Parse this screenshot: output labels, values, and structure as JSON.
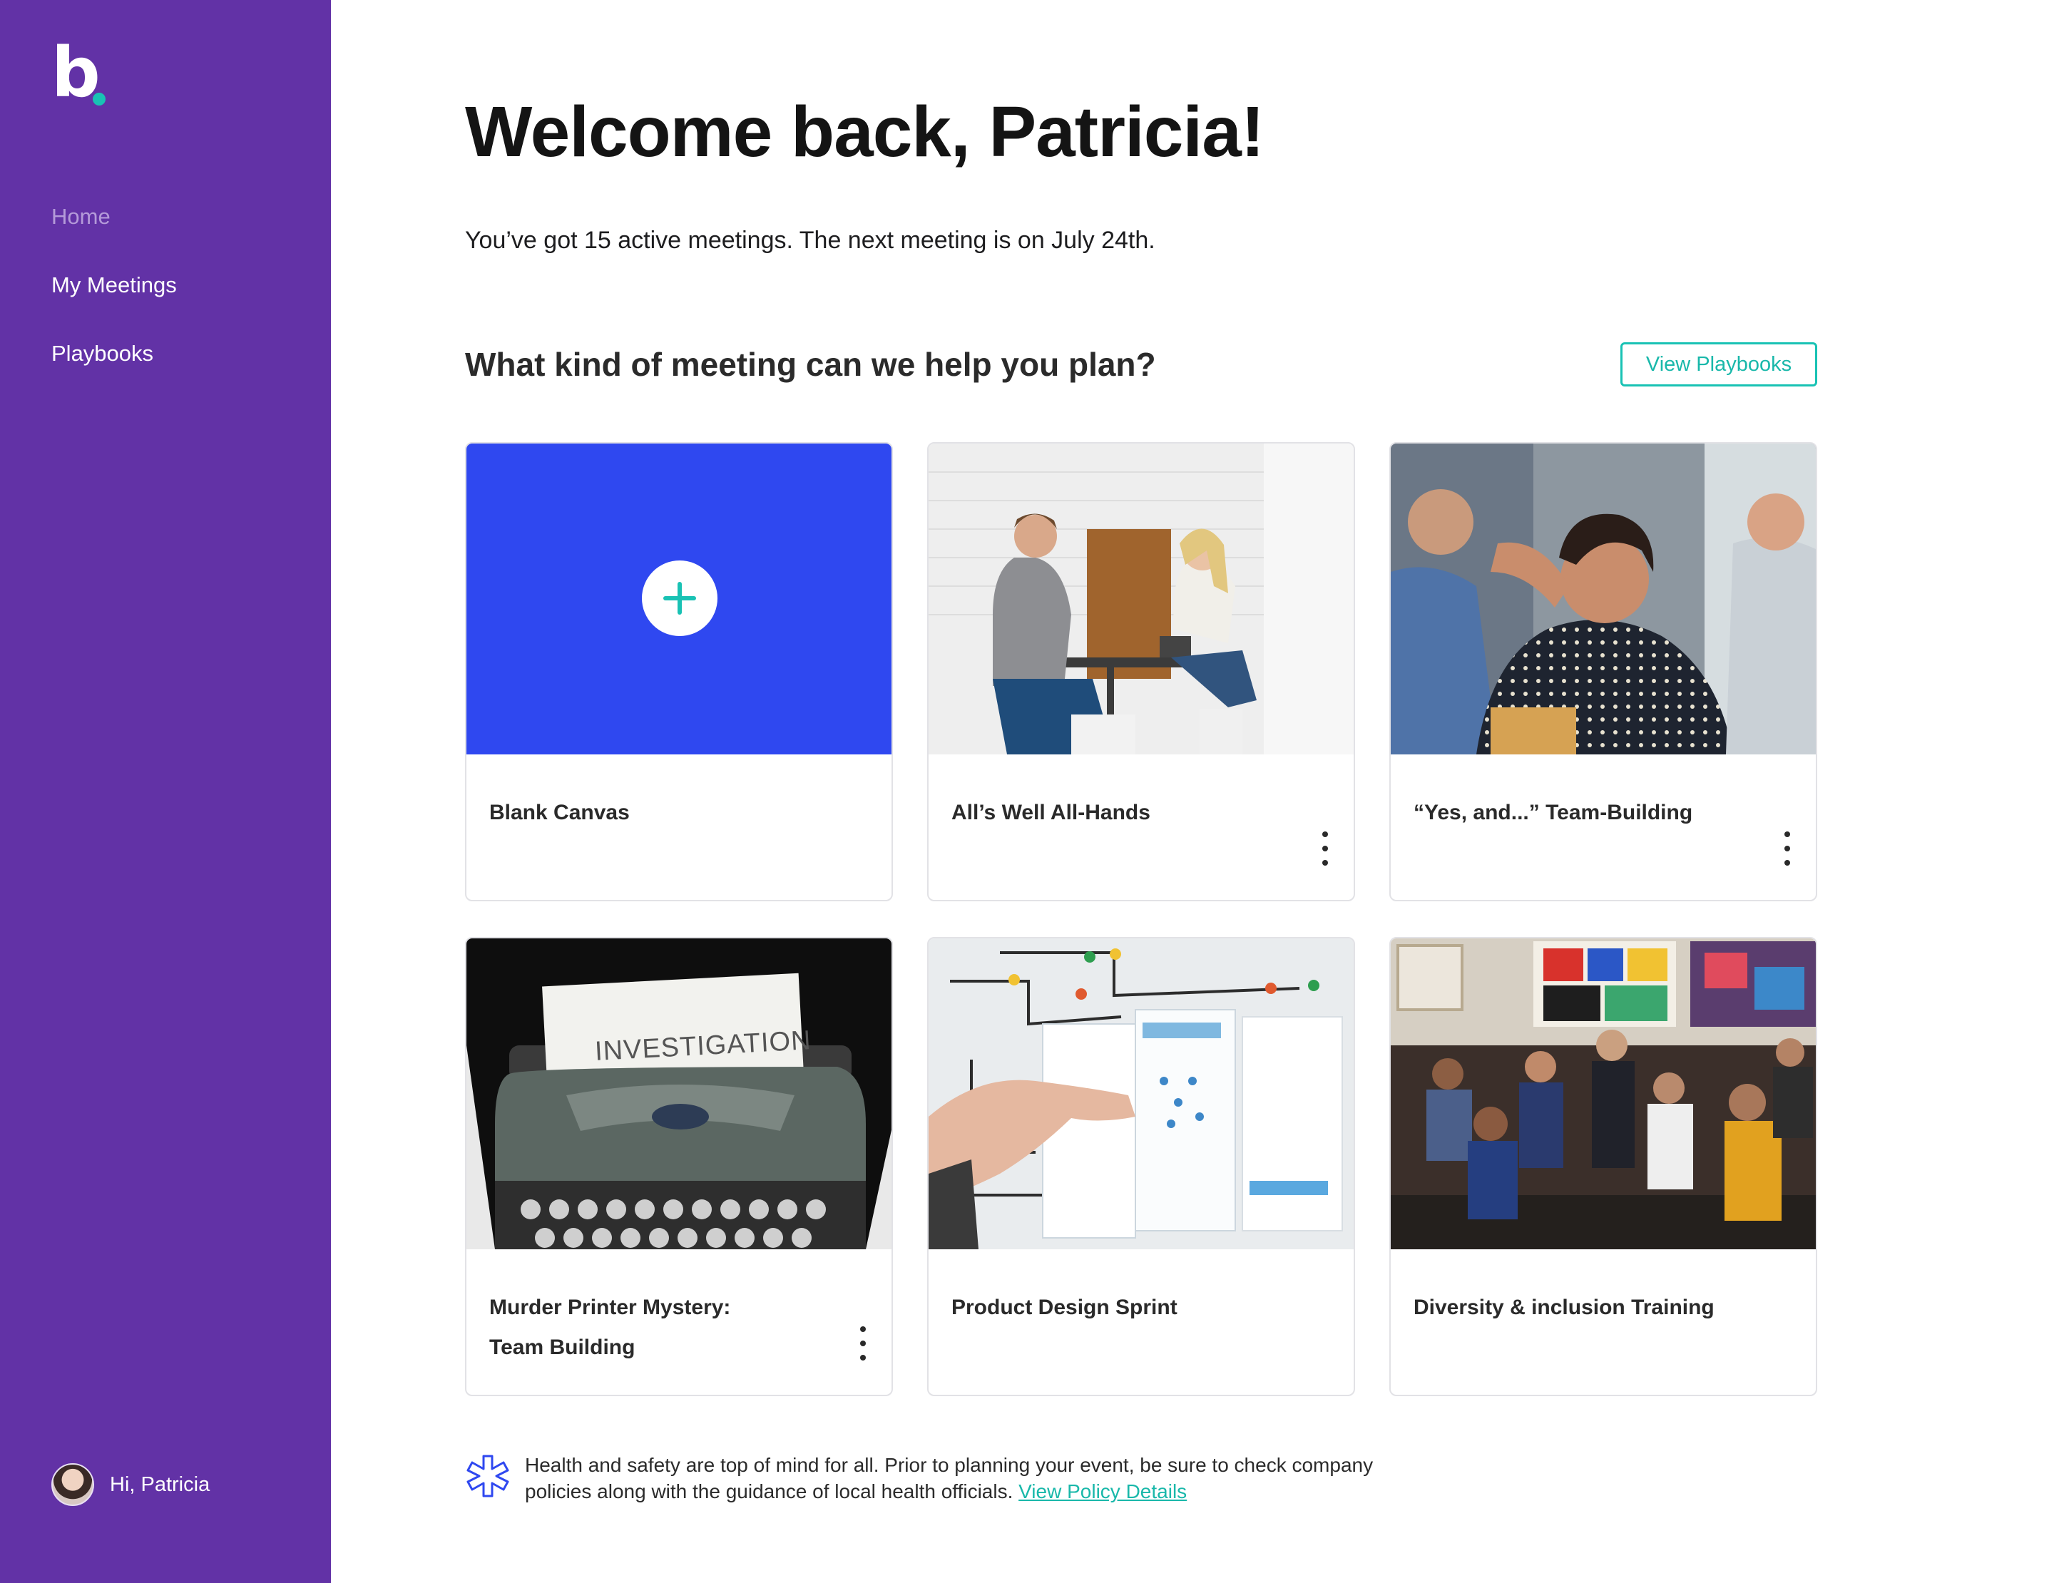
{
  "sidebar": {
    "logo_letter": "b",
    "nav": [
      {
        "label": "Home"
      },
      {
        "label": "My Meetings"
      },
      {
        "label": "Playbooks"
      }
    ],
    "user_greeting": "Hi, Patricia"
  },
  "main": {
    "title": "Welcome back, Patricia!",
    "subtitle": "You’ve got 15 active meetings. The next meeting is on July 24th.",
    "section_question": "What kind of meeting can we help you plan?",
    "view_playbooks_label": "View Playbooks",
    "cards": [
      {
        "label": "Blank Canvas"
      },
      {
        "label": "All’s Well All-Hands"
      },
      {
        "label": "“Yes, and...” Team-Building"
      },
      {
        "label_line1": "Murder Printer Mystery:",
        "label_line2": "Team Building",
        "image_text": "INVESTIGATION"
      },
      {
        "label": "Product Design Sprint"
      },
      {
        "label": "Diversity & inclusion Training"
      }
    ],
    "notice": {
      "text": "Health and safety are top of mind for all. Prior to planning your event, be sure to check company policies along with the guidance of local health officials.",
      "link": "View Policy Details"
    }
  },
  "colors": {
    "sidebar_bg": "#6232a6",
    "accent_teal": "#19c2b4",
    "blank_canvas_blue": "#2f48f0"
  }
}
